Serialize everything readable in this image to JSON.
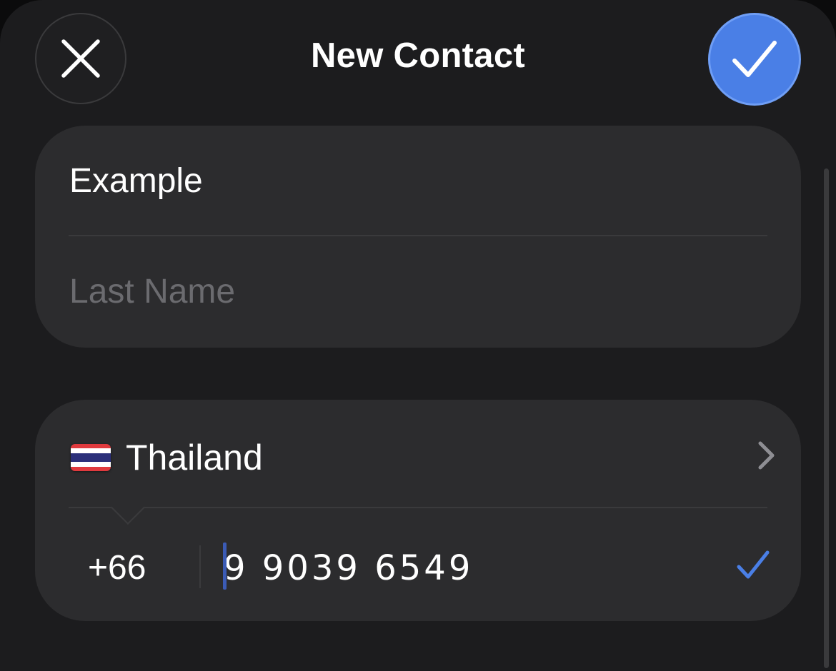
{
  "header": {
    "title": "New Contact",
    "close_icon": "close-icon",
    "done_icon": "checkmark-icon",
    "accent_color": "#4a7fe6"
  },
  "name_card": {
    "first_name_value": "Example",
    "last_name_placeholder": "Last Name"
  },
  "phone_card": {
    "country_flag": "thailand-flag-icon",
    "country_name": "Thailand",
    "chevron_icon": "chevron-right-icon",
    "country_code": "+66",
    "phone_number": "9 9039 6549",
    "valid_icon": "checkmark-icon"
  }
}
